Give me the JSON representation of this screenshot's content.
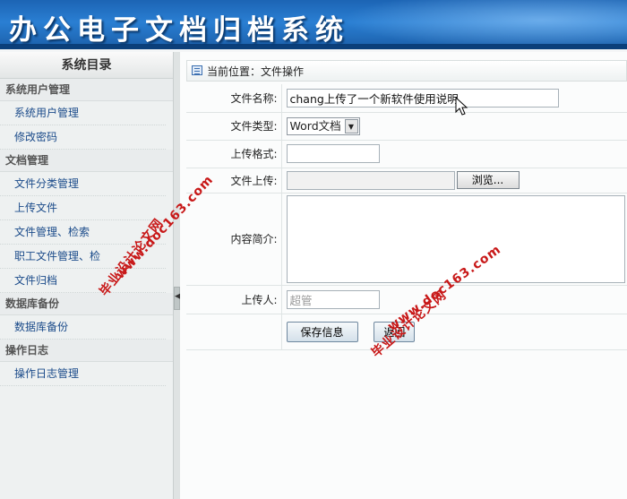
{
  "header": {
    "title": "办公电子文档归档系统"
  },
  "sidebar": {
    "title": "系统目录",
    "groups": [
      {
        "label": "系统用户管理",
        "items": [
          "系统用户管理",
          "修改密码"
        ]
      },
      {
        "label": "文档管理",
        "items": [
          "文件分类管理",
          "上传文件",
          "文件管理、检索",
          "职工文件管理、检",
          "文件归档"
        ]
      },
      {
        "label": "数据库备份",
        "items": [
          "数据库备份"
        ]
      },
      {
        "label": "操作日志",
        "items": [
          "操作日志管理"
        ]
      }
    ]
  },
  "breadcrumb": {
    "text": "当前位置：文件操作"
  },
  "form": {
    "file_name": {
      "label": "文件名称:",
      "value": "chang上传了一个新软件使用说明"
    },
    "file_type": {
      "label": "文件类型:",
      "value": "Word文档"
    },
    "upload_format": {
      "label": "上传格式:",
      "value": ""
    },
    "file_upload": {
      "label": "文件上传:",
      "value": "",
      "browse_label": "浏览..."
    },
    "summary": {
      "label": "内容简介:",
      "value": ""
    },
    "uploader": {
      "label": "上传人:",
      "value": "超管"
    },
    "save_label": "保存信息",
    "back_label": "返回"
  },
  "watermarks": [
    "毕业设计论文网",
    "www.doc163.com"
  ]
}
